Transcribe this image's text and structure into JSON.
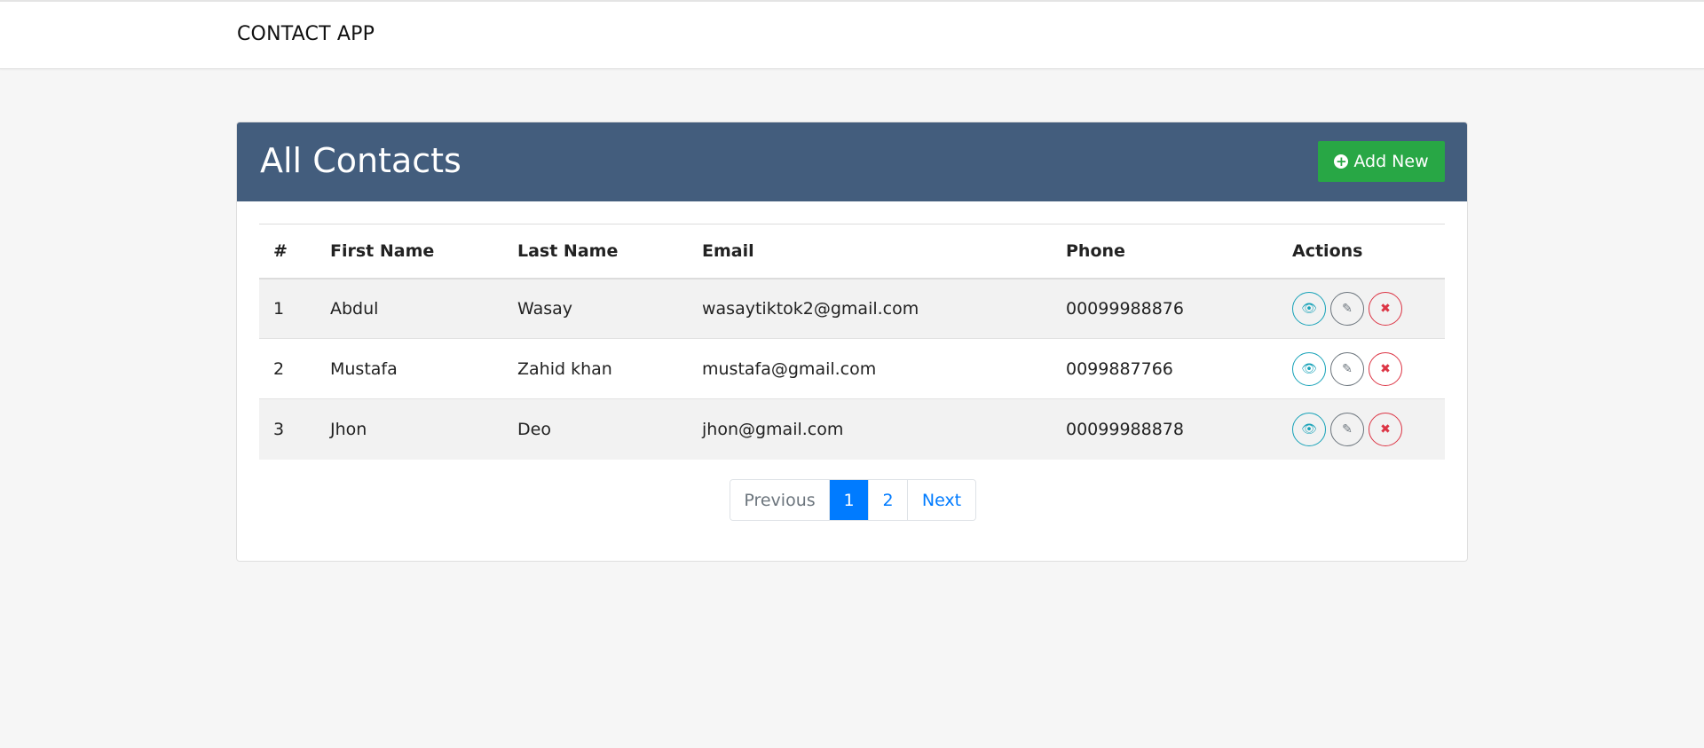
{
  "app": {
    "brand": "CONTACT APP"
  },
  "card": {
    "title": "All Contacts",
    "add_button_label": "Add New"
  },
  "table": {
    "headers": [
      "#",
      "First Name",
      "Last Name",
      "Email",
      "Phone",
      "Actions"
    ],
    "rows": [
      {
        "num": "1",
        "first": "Abdul",
        "last": "Wasay",
        "email": "wasaytiktok2@gmail.com",
        "phone": "00099988876"
      },
      {
        "num": "2",
        "first": "Mustafa",
        "last": "Zahid khan",
        "email": "mustafa@gmail.com",
        "phone": "0099887766"
      },
      {
        "num": "3",
        "first": "Jhon",
        "last": "Deo",
        "email": "jhon@gmail.com",
        "phone": "00099988878"
      }
    ],
    "action_icons": [
      "eye-icon",
      "edit-icon",
      "delete-icon"
    ]
  },
  "pagination": {
    "previous": "Previous",
    "pages": [
      "1",
      "2"
    ],
    "active_page": "1",
    "next": "Next"
  },
  "colors": {
    "header_bg": "#435d7d",
    "add_button": "#28a745",
    "page_bg": "#f6f6f6",
    "view": "#17a2b8",
    "edit": "#6c757d",
    "delete": "#dc3545",
    "active_page": "#007bff"
  }
}
